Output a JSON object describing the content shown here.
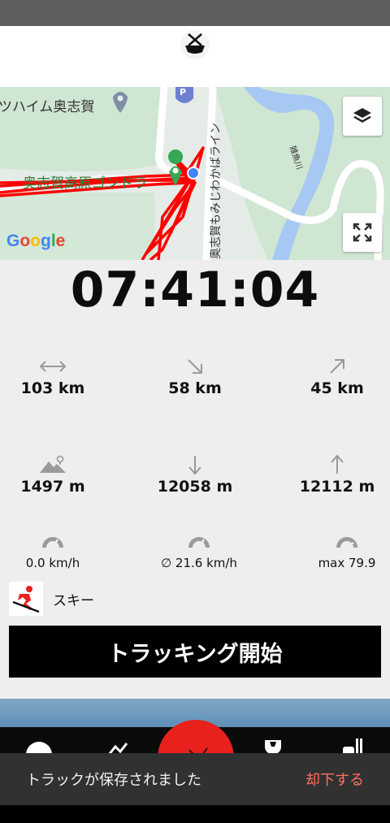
{
  "map": {
    "labels": {
      "place1": "ツハイム奥志賀",
      "place2": "奥志賀高原ゴンドラ",
      "road": "奥志賀もみじわかばライン",
      "river": "雑魚川"
    },
    "attribution": "Google",
    "layers_icon": "layers-icon",
    "fullscreen_icon": "fullscreen-icon"
  },
  "timer": "07:41:04",
  "stats": [
    {
      "id": "distance-total",
      "icon": "distance-icon",
      "value": "103 km"
    },
    {
      "id": "distance-down",
      "icon": "descent-arrow-icon",
      "value": "58 km"
    },
    {
      "id": "distance-up",
      "icon": "ascent-arrow-icon",
      "value": "45 km"
    },
    {
      "id": "altitude",
      "icon": "mountain-icon",
      "value": "1497 m"
    },
    {
      "id": "elevation-down",
      "icon": "down-arrow-icon",
      "value": "12058 m"
    },
    {
      "id": "elevation-up",
      "icon": "up-arrow-icon",
      "value": "12112 m"
    },
    {
      "id": "speed-current",
      "icon": "speedometer-icon",
      "value": "0.0 km/h"
    },
    {
      "id": "speed-avg",
      "icon": "speedometer-icon",
      "value": "∅ 21.6 km/h"
    },
    {
      "id": "speed-max",
      "icon": "speedometer-icon",
      "value": "max 79.9"
    }
  ],
  "activity": {
    "label": "スキー",
    "icon": "skier-icon"
  },
  "start_button": "トラッキング開始",
  "snackbar": {
    "message": "トラックが保存されました",
    "action": "却下する"
  },
  "colors": {
    "accent": "#e8211c",
    "track": "#ff0000",
    "button": "#000000",
    "snack_action": "#ff6f61"
  }
}
